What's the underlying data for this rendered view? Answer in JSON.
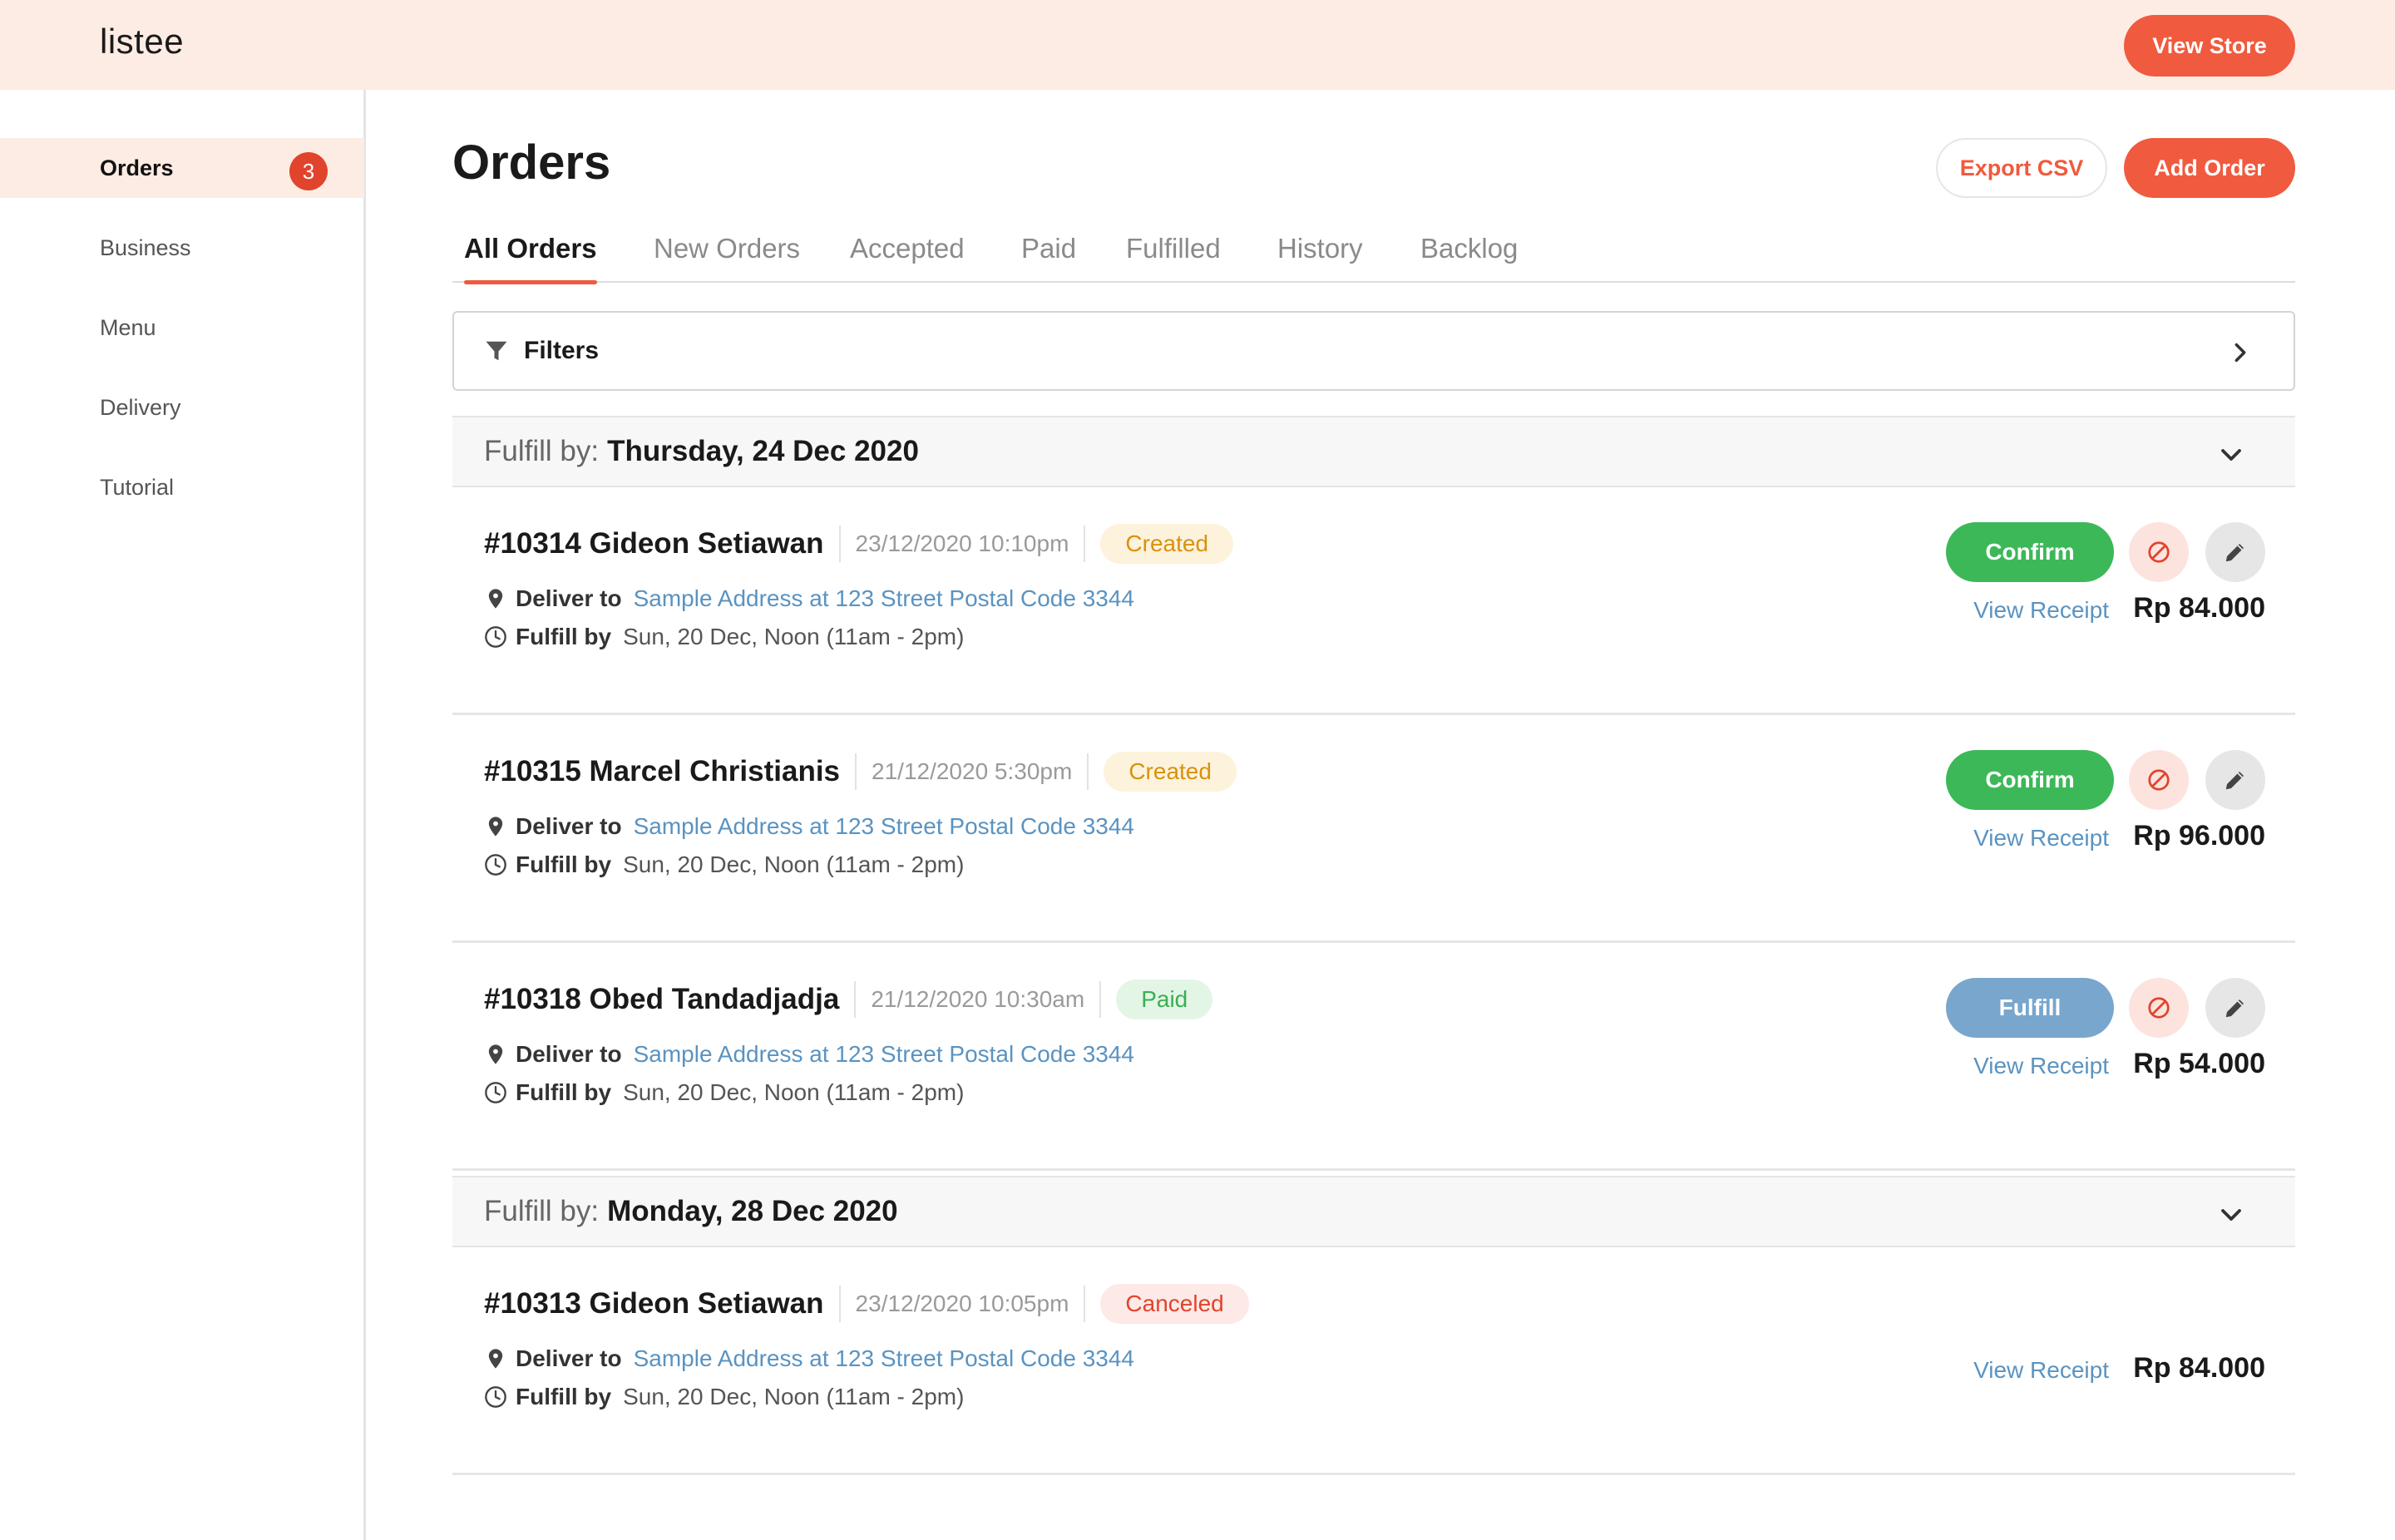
{
  "app": {
    "logo": "listee",
    "view_store": "View Store"
  },
  "sidebar": {
    "items": [
      {
        "label": "Orders",
        "badge": "3",
        "active": true
      },
      {
        "label": "Business"
      },
      {
        "label": "Menu"
      },
      {
        "label": "Delivery"
      },
      {
        "label": "Tutorial"
      }
    ]
  },
  "page": {
    "title": "Orders",
    "export_label": "Export CSV",
    "add_label": "Add Order"
  },
  "tabs": [
    "All Orders",
    "New Orders",
    "Accepted",
    "Paid",
    "Fulfilled",
    "History",
    "Backlog"
  ],
  "filters": {
    "label": "Filters"
  },
  "groups": [
    {
      "label": "Fulfill by:",
      "date": "Thursday, 24 Dec 2020"
    },
    {
      "label": "Fulfill by:",
      "date": "Monday, 28 Dec 2020"
    }
  ],
  "order_labels": {
    "deliver_to": "Deliver to",
    "fulfill_by": "Fulfill by",
    "view_receipt": "View Receipt"
  },
  "orders": [
    {
      "name": "#10314 Gideon Setiawan",
      "date": "23/12/2020  10:10pm",
      "status": "Created",
      "address": "Sample Address at 123 Street Postal Code 3344",
      "fulfill": "Sun, 20 Dec, Noon (11am - 2pm)",
      "price": "Rp 84.000",
      "action": "Confirm"
    },
    {
      "name": "#10315 Marcel Christianis",
      "date": "21/12/2020  5:30pm",
      "status": "Created",
      "address": "Sample Address at 123 Street Postal Code 3344",
      "fulfill": "Sun, 20 Dec, Noon (11am - 2pm)",
      "price": "Rp 96.000",
      "action": "Confirm"
    },
    {
      "name": "#10318 Obed Tandadjadja",
      "date": "21/12/2020  10:30am",
      "status": "Paid",
      "address": "Sample Address at 123 Street Postal Code 3344",
      "fulfill": "Sun, 20 Dec, Noon (11am - 2pm)",
      "price": "Rp 54.000",
      "action": "Fulfill"
    },
    {
      "name": "#10313 Gideon Setiawan",
      "date": "23/12/2020  10:05pm",
      "status": "Canceled",
      "address": "Sample Address at 123 Street Postal Code 3344",
      "fulfill": "Sun, 20 Dec, Noon (11am - 2pm)",
      "price": "Rp 84.000"
    }
  ],
  "colors": {
    "accent": "#f05a3e",
    "topbar": "#fdece3",
    "confirm": "#3db858",
    "fulfill": "#79a6cc",
    "link": "#5a93c1"
  }
}
